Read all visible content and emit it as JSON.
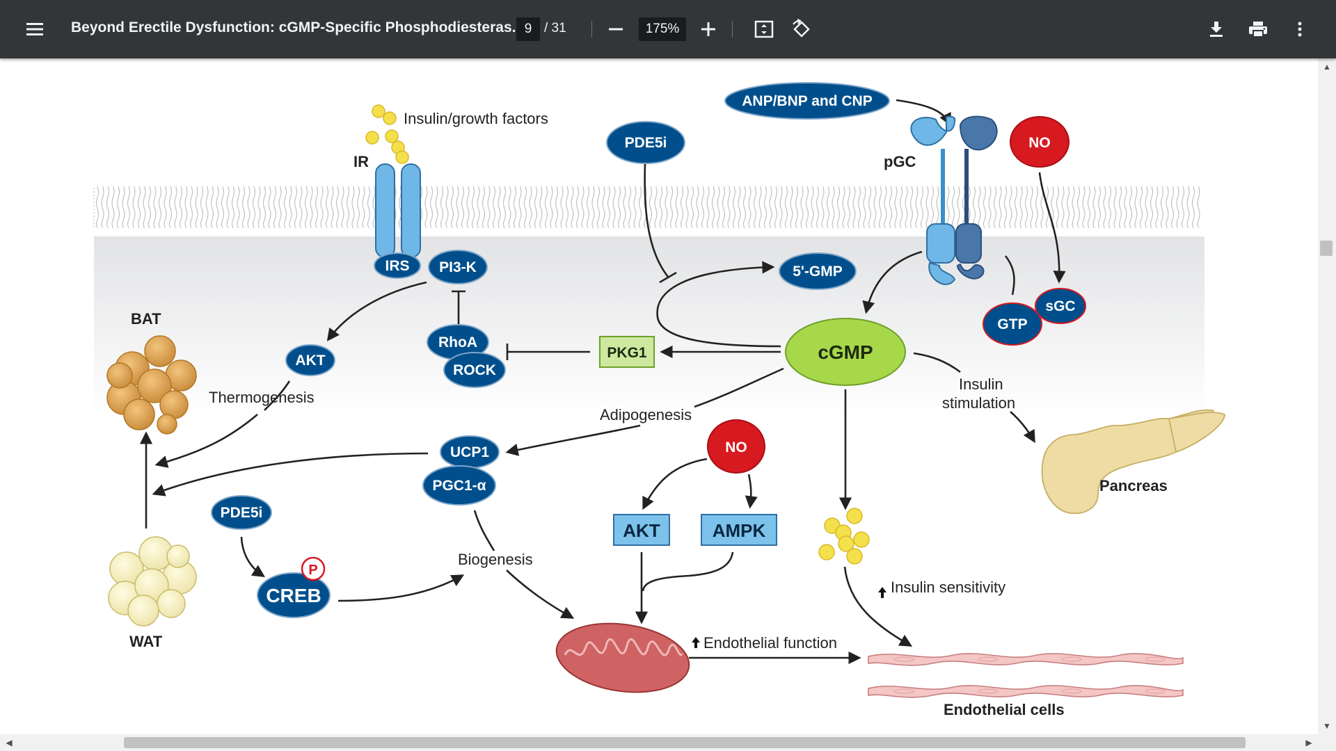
{
  "toolbar": {
    "title": "Beyond Erectile Dysfunction: cGMP-Specific Phosphodiesteras...",
    "page_current": "9",
    "page_total": "/ 31",
    "zoom": "175%",
    "icons": [
      "menu-icon",
      "zoom-out-icon",
      "zoom-in-icon",
      "fit-page-icon",
      "rotate-icon",
      "download-icon",
      "print-icon",
      "more-icon"
    ]
  },
  "diagram": {
    "insulin_growth": "Insulin/growth factors",
    "ir": "IR",
    "irs": "IRS",
    "pi3k": "PI3-K",
    "pde5i_top": "PDE5i",
    "anp": "ANP/BNP and CNP",
    "pgc": "pGC",
    "no_top": "NO",
    "gmp5": "5'-GMP",
    "gtp": "GTP",
    "sgc": "sGC",
    "bat": "BAT",
    "akt_left": "AKT",
    "thermogenesis": "Thermogenesis",
    "rhoa": "RhoA",
    "rock": "ROCK",
    "pkg1": "PKG1",
    "cgmp": "cGMP",
    "insulin_stim_1": "Insulin",
    "insulin_stim_2": "stimulation",
    "adipogenesis": "Adipogenesis",
    "ucp1": "UCP1",
    "pgc1a": "PGC1-α",
    "no_mid": "NO",
    "pancreas": "Pancreas",
    "pde5i_left": "PDE5i",
    "p_badge": "P",
    "creb": "CREB",
    "biogenesis": "Biogenesis",
    "akt_mid": "AKT",
    "ampk": "AMPK",
    "wat": "WAT",
    "insulin_sensitivity": "Insulin sensitivity",
    "endothelial_function": "Endothelial function",
    "endothelial_cells": "Endothelial cells"
  },
  "colors": {
    "toolbar_bg": "#323639",
    "node_blue": "#004f8c",
    "no_red": "#d71920",
    "cgmp_green": "#a7d84a",
    "pkg1_green": "#cfe8a0",
    "box_blue": "#7cc2ea",
    "receptor_light": "#6fb7e6",
    "receptor_dark": "#4a77aa"
  }
}
